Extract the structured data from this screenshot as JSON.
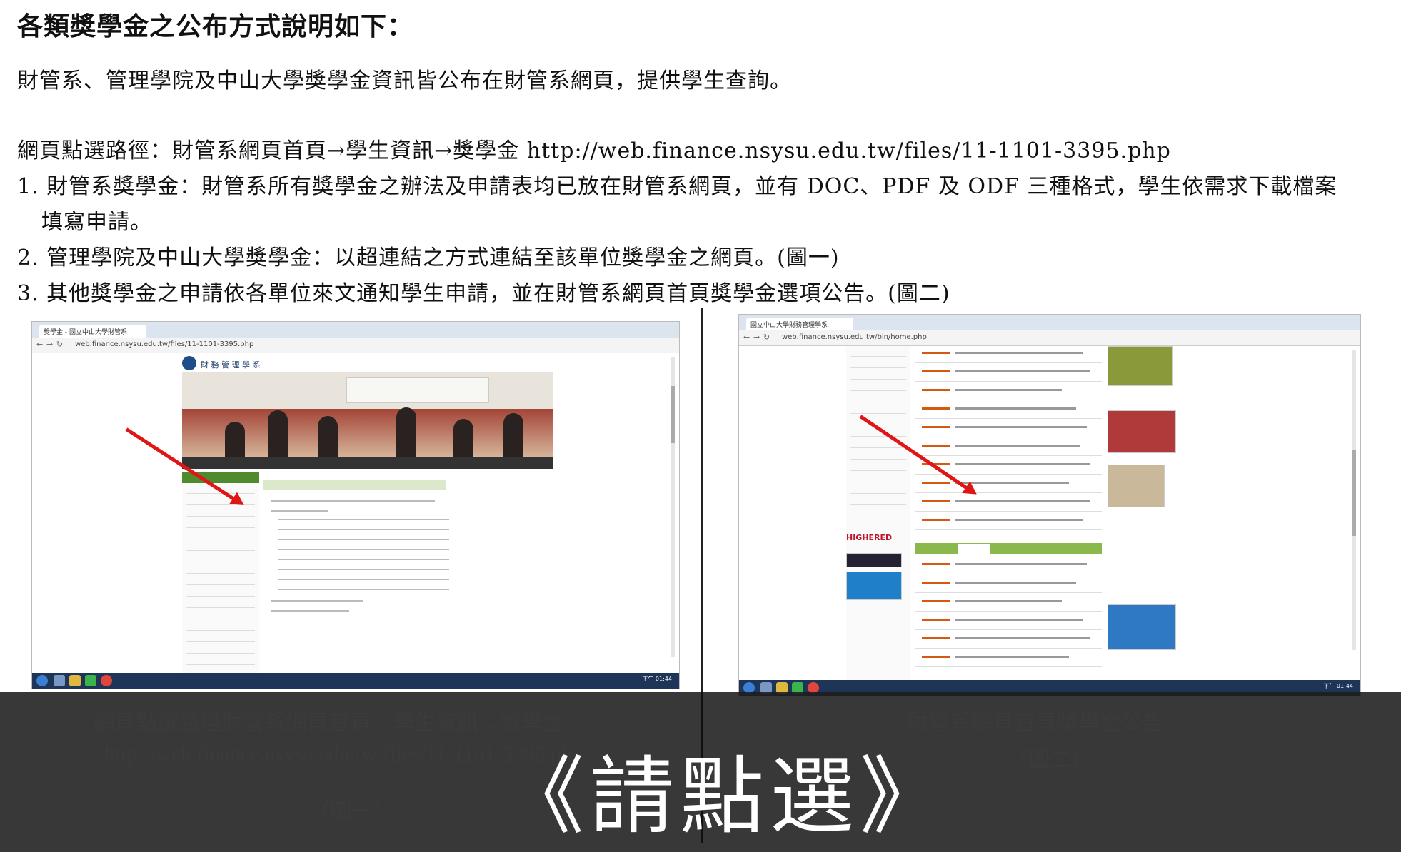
{
  "document": {
    "title": "各類獎學金之公布方式說明如下：",
    "intro": "財管系、管理學院及中山大學獎學金資訊皆公布在財管系網頁，提供學生查詢。",
    "path_line": "網頁點選路徑：財管系網頁首頁→學生資訊→獎學金 http://web.finance.nsysu.edu.tw/files/11-1101-3395.php",
    "item1": "1. 財管系獎學金：財管系所有獎學金之辦法及申請表均已放在財管系網頁，並有 DOC、PDF 及 ODF 三種格式，學生依需求下載檔案",
    "item1_cont": "填寫申請。",
    "item2": "2. 管理學院及中山大學獎學金：以超連結之方式連結至該單位獎學金之網頁。(圖一)",
    "item3": "3. 其他獎學金之申請依各單位來文通知學生申請，並在財管系網頁首頁獎學金選項公告。(圖二)"
  },
  "screenshot1": {
    "url": "web.finance.nsysu.edu.tw/files/11-1101-3395.php",
    "tab_title": "獎學金 - 國立中山大學財管系",
    "site_name": "財 務 管 理 學 系",
    "caption_line1": "網頁點選路徑財管系網頁首頁→學生資訊→獎學金",
    "caption_line2": "http://web.finance.nsysu.edu.tw/files/11-1101-3395.php",
    "caption_fig": "（圖一）",
    "clock": "下午 01:44"
  },
  "screenshot2": {
    "url": "web.finance.nsysu.edu.tw/bin/home.php",
    "tab_title": "國立中山大學財務管理學系",
    "caption_line1": "財管系網頁首頁獎學金公告",
    "caption_fig": "（圖二）",
    "clock": "下午 01:44",
    "higher_label": "HIGHERED"
  },
  "overlay": {
    "click_label": "《請點選》"
  },
  "colors": {
    "arrow": "#e01515",
    "overlay": "#1c1c1c",
    "nav_green": "#4e8a2e"
  }
}
